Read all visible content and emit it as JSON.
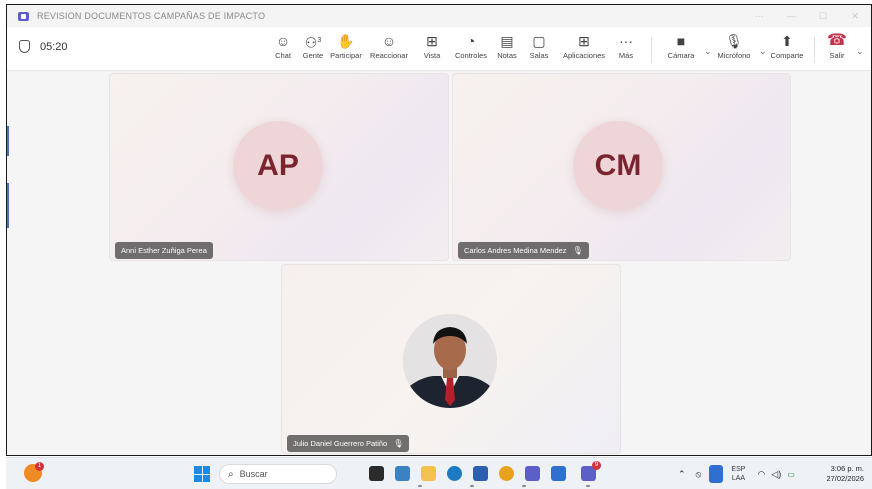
{
  "window": {
    "title": "REVISION DOCUMENTOS CAMPAÑAS DE IMPACTO",
    "controls": [
      "···",
      "—",
      "☐",
      "✕"
    ]
  },
  "toolbar": {
    "timer": "05:20",
    "buttons": [
      {
        "label": "Chat",
        "icon": "chat-icon",
        "glyph": "☺"
      },
      {
        "label": "Gente",
        "icon": "people-icon",
        "glyph": "👥"
      },
      {
        "label": "Participar",
        "icon": "raise-hand-icon",
        "glyph": "✋"
      },
      {
        "label": "Reaccionar",
        "icon": "react-icon",
        "glyph": "☺"
      },
      {
        "label": "Vista",
        "icon": "view-icon",
        "glyph": "▦"
      },
      {
        "label": "Controles",
        "icon": "controls-icon",
        "glyph": "⚙"
      },
      {
        "label": "Notas",
        "icon": "notes-icon",
        "glyph": "▤"
      },
      {
        "label": "Salas",
        "icon": "rooms-icon",
        "glyph": "▢"
      },
      {
        "label": "Aplicaciones",
        "icon": "apps-icon",
        "glyph": "⊞"
      },
      {
        "label": "Más",
        "icon": "more-icon",
        "glyph": "···"
      }
    ],
    "people_count": "3",
    "camera_label": "Cámara",
    "mic_label": "Micrófono",
    "share_label": "Comparte",
    "leave_label": "Salir"
  },
  "participants": [
    {
      "initials": "AP",
      "name": "Anni Esther Zuñiga Perea",
      "muted": false
    },
    {
      "initials": "CM",
      "name": "Carlos Andres Medina Mendez",
      "muted": true
    },
    {
      "initials": "",
      "name": "Julio Daniel Guerrero Patiño",
      "muted": true
    }
  ],
  "taskbar": {
    "weather_badge": "1",
    "search_placeholder": "Buscar",
    "lang_top": "ESP",
    "lang_bottom": "LAA",
    "time": "3:06 p. m.",
    "date": "27/02/2026",
    "store_badge": "9"
  },
  "colors": {
    "accent": "#5b5fc7",
    "leave": "#c4314b",
    "avatar_bg": "#eed6d8",
    "avatar_text": "#7a2430"
  }
}
